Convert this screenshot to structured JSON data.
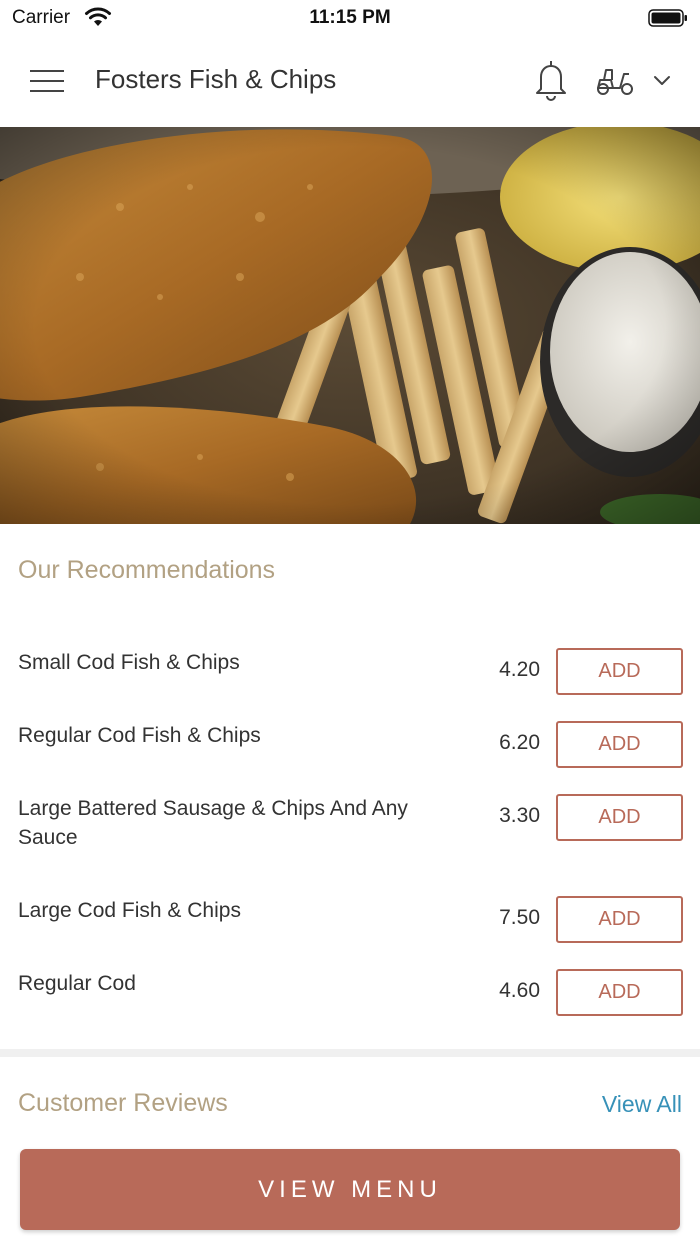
{
  "status_bar": {
    "carrier": "Carrier",
    "time": "11:15 PM"
  },
  "header": {
    "title": "Fosters Fish & Chips",
    "icons": [
      "menu-icon",
      "bell-icon",
      "scooter-icon",
      "chevron-down-icon"
    ]
  },
  "hero": {
    "image": "fish-and-chips-photo"
  },
  "recommendations": {
    "title": "Our Recommendations",
    "items": [
      {
        "name": "Small Cod Fish & Chips",
        "price": "4.20",
        "action": "ADD"
      },
      {
        "name": "Regular Cod Fish & Chips",
        "price": "6.20",
        "action": "ADD"
      },
      {
        "name": "Large Battered Sausage & Chips And Any Sauce",
        "price": "3.30",
        "action": "ADD"
      },
      {
        "name": "Large Cod Fish & Chips",
        "price": "7.50",
        "action": "ADD"
      },
      {
        "name": "Regular Cod",
        "price": "4.60",
        "action": "ADD"
      }
    ]
  },
  "reviews": {
    "title": "Customer Reviews",
    "view_all": "View All"
  },
  "footer": {
    "view_menu": "VIEW MENU"
  },
  "colors": {
    "accent": "#b86a59",
    "section_title": "#b2a183",
    "link": "#3791b8"
  }
}
